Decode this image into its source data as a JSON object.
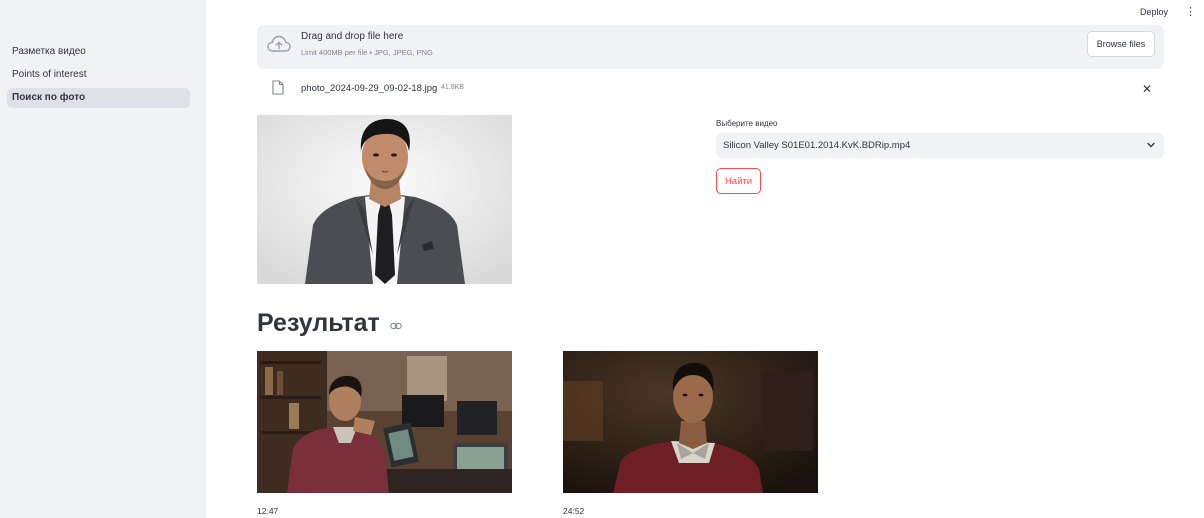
{
  "header": {
    "deploy_label": "Deploy",
    "menu_glyph": "⋮"
  },
  "sidebar": {
    "items": [
      {
        "label": "Разметка видео",
        "active": false
      },
      {
        "label": "Points of interest",
        "active": false
      },
      {
        "label": "Поиск по фото",
        "active": true
      }
    ]
  },
  "uploader": {
    "title": "Drag and drop file here",
    "limit": "Limit 400MB per file • JPG, JPEG, PNG",
    "browse_label": "Browse files",
    "icon": "cloud-upload-icon"
  },
  "uploaded_file": {
    "name": "photo_2024-09-29_09-02-18.jpg",
    "size": "41.8KB",
    "remove_glyph": "✕"
  },
  "video_select": {
    "label": "Выберите видео",
    "value": "Silicon Valley S01E01.2014.KvK.BDRip.mp4"
  },
  "find_button": {
    "label": "Найти"
  },
  "results": {
    "title": "Результат",
    "frames": [
      {
        "timecode": "12:47"
      },
      {
        "timecode": "24:52"
      }
    ]
  },
  "colors": {
    "sidebar_bg": "#f0f2f6",
    "accent": "#ff4b4b",
    "text": "#31333f",
    "muted": "#808495"
  }
}
